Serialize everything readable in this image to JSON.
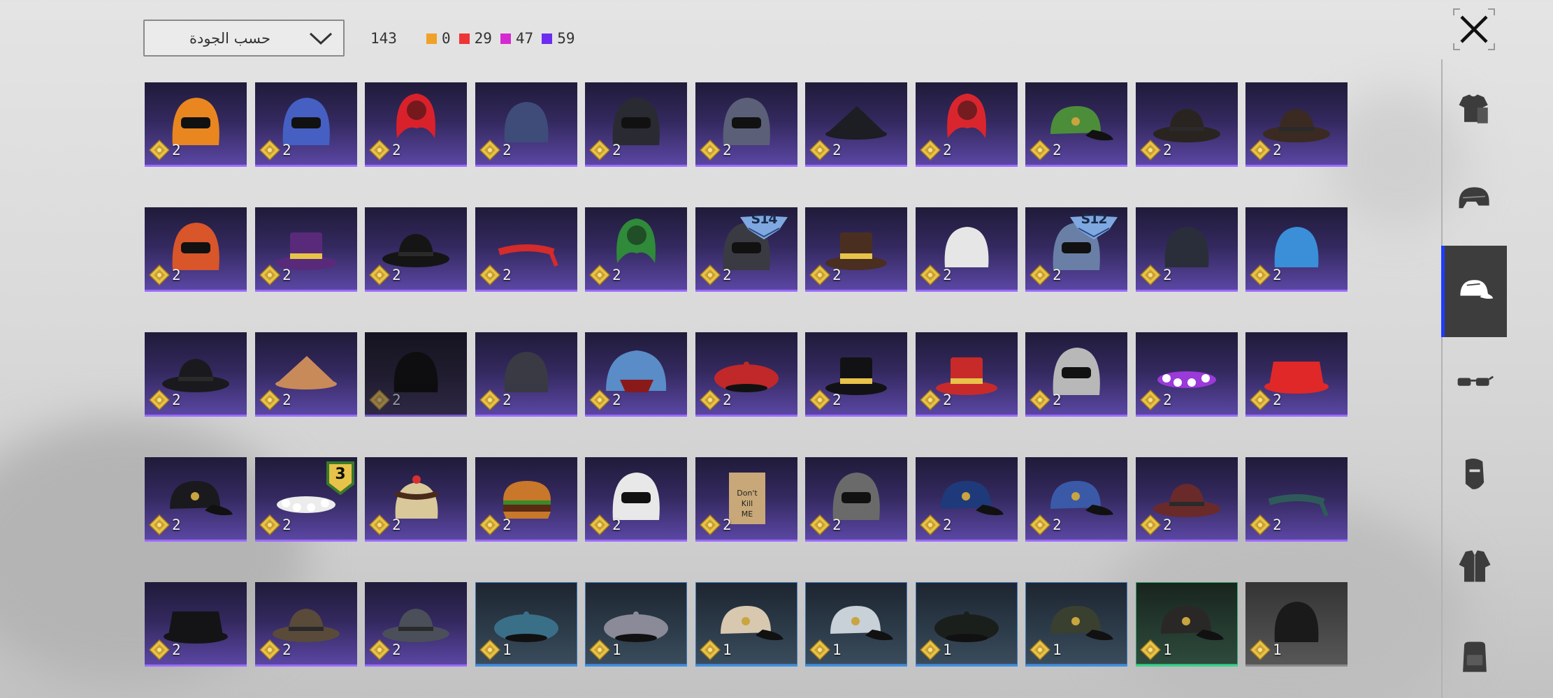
{
  "sort": {
    "label": "حسب الجودة"
  },
  "stats": {
    "total": "143",
    "quality_counts": [
      {
        "name": "legendary",
        "value": "0",
        "color": "#f0a228"
      },
      {
        "name": "mythic",
        "value": "29",
        "color": "#ee3535"
      },
      {
        "name": "epic",
        "value": "47",
        "color": "#d52ad0"
      },
      {
        "name": "rare",
        "value": "59",
        "color": "#6d2cf0"
      }
    ]
  },
  "categories": [
    {
      "name": "outfits",
      "icon": "outfit-icon",
      "active": false
    },
    {
      "name": "helmets",
      "icon": "helmet-icon",
      "active": false
    },
    {
      "name": "hats",
      "icon": "cap-icon",
      "active": true
    },
    {
      "name": "glasses",
      "icon": "glasses-icon",
      "active": false
    },
    {
      "name": "masks",
      "icon": "mask-icon",
      "active": false
    },
    {
      "name": "jackets",
      "icon": "jacket-icon",
      "active": false
    },
    {
      "name": "backpacks",
      "icon": "backpack-icon",
      "active": false
    }
  ],
  "items": [
    {
      "icon": "visor-helmet-icon",
      "count": "2",
      "quality": "epic",
      "color": "#e9861f"
    },
    {
      "icon": "arcade-helmet-icon",
      "count": "2",
      "quality": "epic",
      "color": "#4560c2"
    },
    {
      "icon": "red-pigtails-icon",
      "count": "2",
      "quality": "epic",
      "color": "#d9212c"
    },
    {
      "icon": "beanie-icon",
      "count": "2",
      "quality": "epic",
      "color": "#3f4c7a"
    },
    {
      "icon": "samurai-helmet-icon",
      "count": "2",
      "quality": "epic",
      "color": "#2a2a32"
    },
    {
      "icon": "horned-helmet-icon",
      "count": "2",
      "quality": "epic",
      "color": "#5b5f78"
    },
    {
      "icon": "witch-hat-icon",
      "count": "2",
      "quality": "epic",
      "color": "#1d1d24"
    },
    {
      "icon": "red-mohawk-icon",
      "count": "2",
      "quality": "epic",
      "color": "#d9262e"
    },
    {
      "icon": "green-cap-icon",
      "count": "2",
      "quality": "epic",
      "color": "#4c8d3a"
    },
    {
      "icon": "sombrero-icon",
      "count": "2",
      "quality": "epic",
      "color": "#2a2420"
    },
    {
      "icon": "steampunk-hat-icon",
      "count": "2",
      "quality": "epic",
      "color": "#3a2a22"
    },
    {
      "icon": "ponytail-mask-icon",
      "count": "2",
      "quality": "epic",
      "color": "#d9552a"
    },
    {
      "icon": "purple-top-hat-icon",
      "count": "2",
      "quality": "epic",
      "color": "#5a2a7a"
    },
    {
      "icon": "gold-band-hat-icon",
      "count": "2",
      "quality": "epic",
      "color": "#151515"
    },
    {
      "icon": "racing-bandana-icon",
      "count": "2",
      "quality": "epic",
      "color": "#d42b2b"
    },
    {
      "icon": "green-pigtails-icon",
      "count": "2",
      "quality": "epic",
      "color": "#2f8a3a"
    },
    {
      "icon": "spartan-helmet-icon",
      "count": "2",
      "quality": "epic",
      "color": "#3a3a42",
      "badge": "S14"
    },
    {
      "icon": "brown-top-hat-icon",
      "count": "2",
      "quality": "epic",
      "color": "#4a2f20"
    },
    {
      "icon": "white-bonnet-icon",
      "count": "2",
      "quality": "epic",
      "color": "#e6e6e6"
    },
    {
      "icon": "space-helmet-icon",
      "count": "2",
      "quality": "epic",
      "color": "#6a7fa6",
      "badge": "S12"
    },
    {
      "icon": "goggle-beanie-icon",
      "count": "2",
      "quality": "epic",
      "color": "#2a2e3a"
    },
    {
      "icon": "pompom-beanie-icon",
      "count": "2",
      "quality": "epic",
      "color": "#3a8fd8"
    },
    {
      "icon": "pirate-hat-icon",
      "count": "2",
      "quality": "epic",
      "color": "#1a1a1e"
    },
    {
      "icon": "conical-hat-icon",
      "count": "2",
      "quality": "epic",
      "color": "#c98a5a"
    },
    {
      "icon": "balaclava-icon",
      "count": "2",
      "quality": "epic-dark",
      "color": "#0e0e10",
      "dim": true
    },
    {
      "icon": "wrestler-mask-icon",
      "count": "2",
      "quality": "epic",
      "color": "#3a3a45"
    },
    {
      "icon": "shark-hat-icon",
      "count": "2",
      "quality": "epic",
      "color": "#5a8cc8"
    },
    {
      "icon": "red-beret-icon",
      "count": "2",
      "quality": "epic",
      "color": "#c0282a"
    },
    {
      "icon": "black-top-hat-icon",
      "count": "2",
      "quality": "epic",
      "color": "#121214"
    },
    {
      "icon": "red-top-hat-icon",
      "count": "2",
      "quality": "epic",
      "color": "#c82a2a"
    },
    {
      "icon": "shark-head-icon",
      "count": "2",
      "quality": "epic",
      "color": "#b8b8b8"
    },
    {
      "icon": "flower-crown-icon",
      "count": "2",
      "quality": "epic",
      "color": "#9a3ad8"
    },
    {
      "icon": "red-bucket-hat-icon",
      "count": "2",
      "quality": "epic",
      "color": "#e02828"
    },
    {
      "icon": "police-cap-icon",
      "count": "2",
      "quality": "epic",
      "color": "#1a1a1e"
    },
    {
      "icon": "daisy-crown-icon",
      "count": "2",
      "quality": "epic",
      "color": "#ececec",
      "badge3": "3"
    },
    {
      "icon": "cake-hat-icon",
      "count": "2",
      "quality": "epic",
      "color": "#d8c89a"
    },
    {
      "icon": "burger-hat-icon",
      "count": "2",
      "quality": "epic",
      "color": "#c9772a"
    },
    {
      "icon": "headlamp-icon",
      "count": "2",
      "quality": "epic",
      "color": "#e8e8e8"
    },
    {
      "icon": "paper-bag-icon",
      "count": "2",
      "quality": "epic",
      "color": "#c8a878"
    },
    {
      "icon": "headband-icon",
      "count": "2",
      "quality": "epic",
      "color": "#6a6a6a"
    },
    {
      "icon": "captain-cap-icon",
      "count": "2",
      "quality": "epic",
      "color": "#1f3a7a"
    },
    {
      "icon": "garrison-cap-icon",
      "count": "2",
      "quality": "epic",
      "color": "#3a5aa8"
    },
    {
      "icon": "fedora-icon",
      "count": "2",
      "quality": "epic",
      "color": "#6a2a2a"
    },
    {
      "icon": "patterned-bandana-icon",
      "count": "2",
      "quality": "epic",
      "color": "#2f5a5a"
    },
    {
      "icon": "black-bucket-hat-icon",
      "count": "2",
      "quality": "epic",
      "color": "#141416"
    },
    {
      "icon": "aviator-hat-icon",
      "count": "2",
      "quality": "epic",
      "color": "#5a4a3a"
    },
    {
      "icon": "fishing-hat-icon",
      "count": "2",
      "quality": "epic",
      "color": "#4a4f5a"
    },
    {
      "icon": "blue-beret-icon",
      "count": "1",
      "quality": "blue",
      "color": "#3a6f88"
    },
    {
      "icon": "grey-beret-icon",
      "count": "1",
      "quality": "blue",
      "color": "#8a8a98"
    },
    {
      "icon": "baseball-cap-icon",
      "count": "1",
      "quality": "blue",
      "color": "#d8c8b0"
    },
    {
      "icon": "baseball-cap-icon",
      "count": "1",
      "quality": "blue",
      "color": "#c8d0d8"
    },
    {
      "icon": "black-beret-icon",
      "count": "1",
      "quality": "blue",
      "color": "#1a1f1c"
    },
    {
      "icon": "camo-cap-icon",
      "count": "1",
      "quality": "blue",
      "color": "#3a4030"
    },
    {
      "icon": "military-cap-icon",
      "count": "1",
      "quality": "green",
      "color": "#2a2826"
    },
    {
      "icon": "black-beanie-icon",
      "count": "1",
      "quality": "gray",
      "color": "#1a1a1a"
    }
  ]
}
